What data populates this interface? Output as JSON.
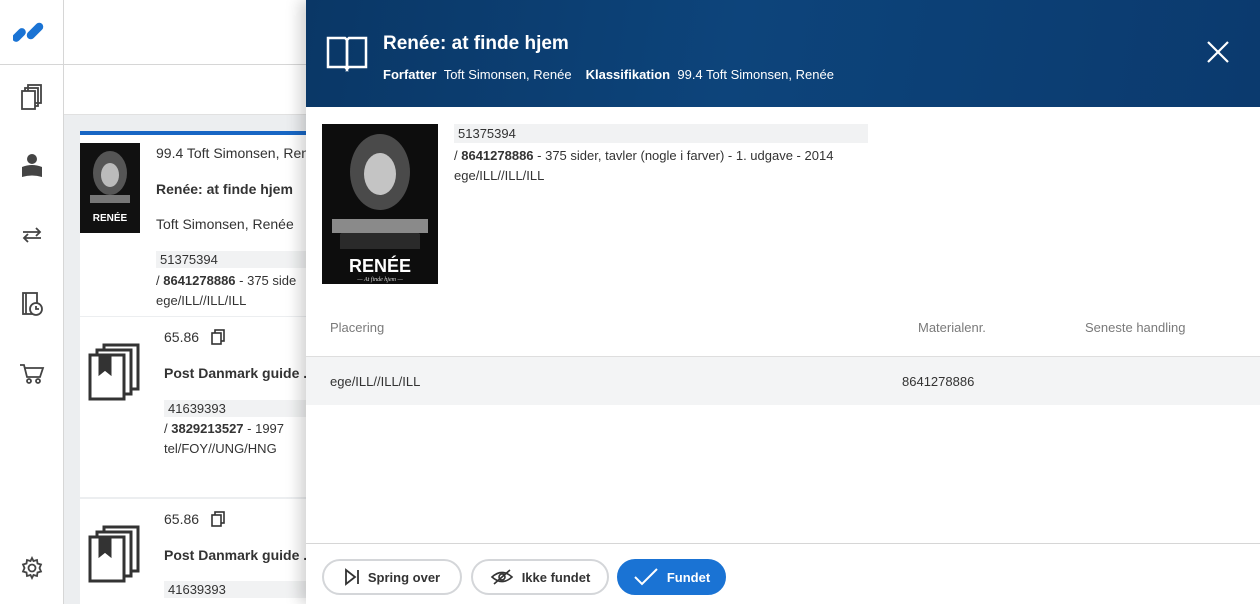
{
  "app": {
    "logo_icon": "brand-logo-icon",
    "accent_color": "#1a73d4",
    "header_color": "#0d447b"
  },
  "rail": {
    "items": [
      {
        "icon": "copies-icon"
      },
      {
        "icon": "reader-icon"
      },
      {
        "icon": "transfer-arrows-icon"
      },
      {
        "icon": "history-book-icon"
      },
      {
        "icon": "cart-icon"
      },
      {
        "icon": "gear-icon"
      }
    ]
  },
  "background_list": {
    "cards": [
      {
        "classification": "99.4 Toft Simonsen, Ren",
        "title": "Renée: at finde hjem",
        "author": "Toft Simonsen, Renée",
        "id": "51375394",
        "barcode": "8641278886",
        "rest": " - 375 side",
        "location": "ege/ILL//ILL/ILL",
        "cover_text": "RENÉE"
      },
      {
        "classification": "65.86",
        "title": "Post Danmark guide ...",
        "id": "41639393",
        "barcode": "3829213527",
        "rest": " - 1997",
        "location": "tel/FOY//UNG/HNG"
      },
      {
        "classification": "65.86",
        "title": "Post Danmark guide ...",
        "id": "41639393"
      }
    ]
  },
  "drawer": {
    "title": "Renée: at finde hjem",
    "author_label": "Forfatter",
    "author_value": "Toft Simonsen, Renée",
    "class_label": "Klassifikation",
    "class_value": "99.4 Toft Simonsen, Renée",
    "cover_title": "RENÉE",
    "cover_subtitle": "— At finde hjem —",
    "record_id": "51375394",
    "slash": "/ ",
    "barcode": "8641278886",
    "details": " - 375 sider, tavler (nogle i farver) - 1. udgave - 2014",
    "location_line": "ege/ILL//ILL/ILL",
    "table": {
      "headers": [
        "Placering",
        "Materialenr.",
        "Seneste handling"
      ],
      "rows": [
        {
          "placering": "ege/ILL//ILL/ILL",
          "materialenr": "8641278886",
          "seneste": ""
        }
      ]
    },
    "buttons": {
      "skip": "Spring over",
      "not_found": "Ikke fundet",
      "found": "Fundet"
    }
  }
}
